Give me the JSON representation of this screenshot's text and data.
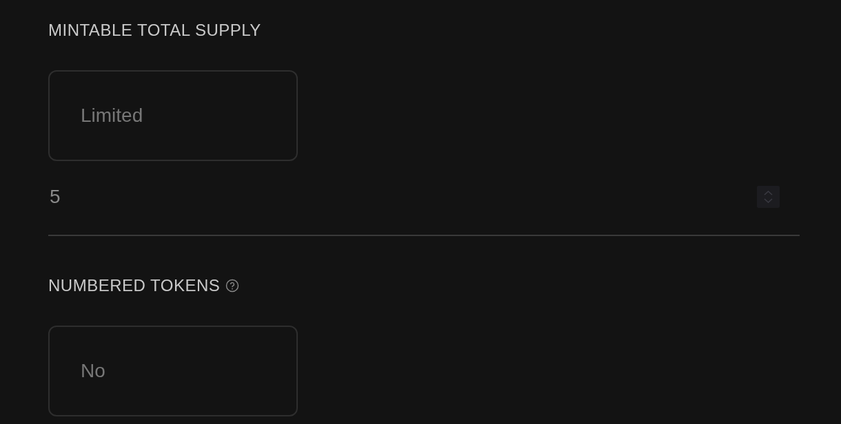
{
  "fields": [
    {
      "kind": "select",
      "label": "MINTABLE TOTAL SUPPLY",
      "help": false,
      "value": "Limited",
      "number": "5"
    },
    {
      "kind": "select",
      "label": "NUMBERED TOKENS",
      "help": true,
      "value": "No"
    }
  ]
}
